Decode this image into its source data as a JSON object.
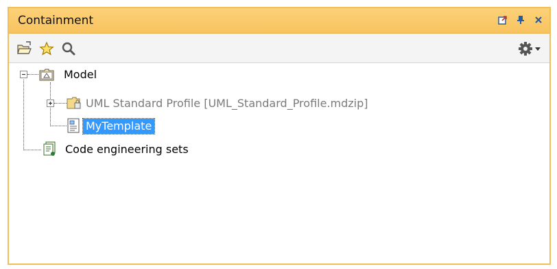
{
  "panel": {
    "title": "Containment",
    "accent_color": "#f8c35f",
    "selection_color": "#3399ff"
  },
  "title_controls": [
    {
      "icon": "undock-icon"
    },
    {
      "icon": "pin-icon"
    },
    {
      "icon": "close-icon"
    }
  ],
  "toolbar": {
    "left_tools": [
      {
        "icon": "open-folder-icon"
      },
      {
        "icon": "favorite-star-icon"
      },
      {
        "icon": "search-icon"
      }
    ],
    "right_tools": [
      {
        "icon": "gear-icon"
      },
      {
        "icon": "dropdown-arrow-icon"
      }
    ]
  },
  "tree": {
    "nodes": [
      {
        "label": "Model",
        "icon": "model-package-icon",
        "expanded": true
      },
      {
        "label": "UML Standard Profile [UML_Standard_Profile.mdzip]",
        "icon": "read-only-package-icon",
        "expanded": false
      },
      {
        "label": "MyTemplate",
        "icon": "template-diagram-icon",
        "selected": true
      },
      {
        "label": "Code engineering sets",
        "icon": "code-engineering-sets-icon"
      }
    ]
  }
}
